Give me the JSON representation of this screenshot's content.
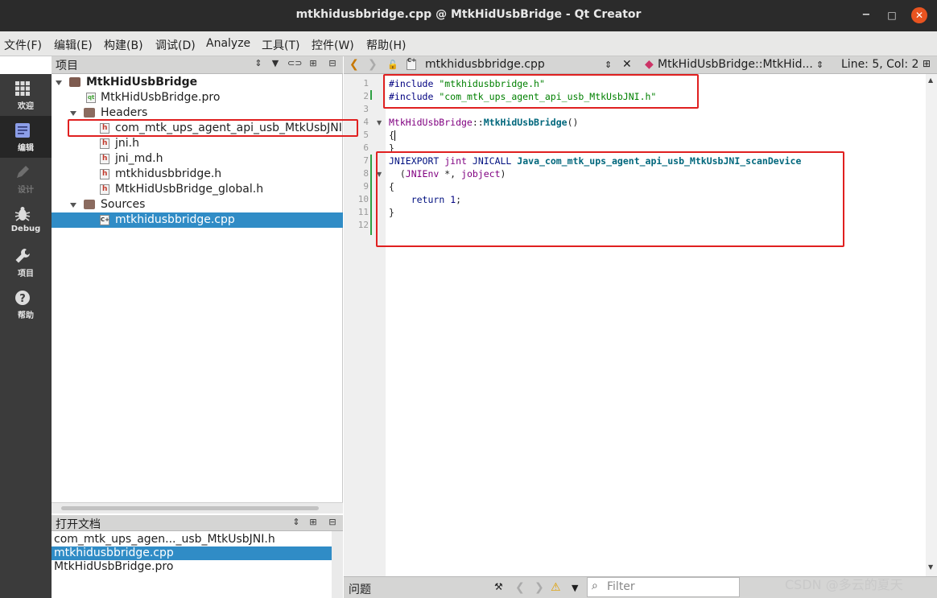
{
  "window": {
    "title": "mtkhidusbbridge.cpp @ MtkHidUsbBridge - Qt Creator",
    "min_glyph": "−",
    "max_glyph": "□",
    "close_glyph": "✕"
  },
  "menu": [
    "文件(F)",
    "编辑(E)",
    "构建(B)",
    "调试(D)",
    "Analyze",
    "工具(T)",
    "控件(W)",
    "帮助(H)"
  ],
  "modes": [
    {
      "label": "欢迎",
      "icon": "grid-icon"
    },
    {
      "label": "编辑",
      "icon": "edit-icon"
    },
    {
      "label": "设计",
      "icon": "pencil-icon"
    },
    {
      "label": "Debug",
      "icon": "bug-icon"
    },
    {
      "label": "项目",
      "icon": "wrench-icon"
    },
    {
      "label": "帮助",
      "icon": "help-icon"
    }
  ],
  "project_pane": {
    "title": "项目",
    "project": "MtkHidUsbBridge",
    "pro_file": "MtkHidUsbBridge.pro",
    "headers_label": "Headers",
    "headers": [
      "com_mtk_ups_agent_api_usb_MtkUsbJNI.h",
      "jni.h",
      "jni_md.h",
      "mtkhidusbbridge.h",
      "MtkHidUsbBridge_global.h"
    ],
    "sources_label": "Sources",
    "sources": [
      "mtkhidusbbridge.cpp"
    ]
  },
  "open_docs": {
    "title": "打开文档",
    "items": [
      "com_mtk_ups_agen..._usb_MtkUsbJNI.h",
      "mtkhidusbbridge.cpp",
      "MtkHidUsbBridge.pro"
    ]
  },
  "editor": {
    "file_name": "mtkhidusbbridge.cpp",
    "symbol": "MtkHidUsbBridge::MtkHid...",
    "position": "Line: 5, Col: 2",
    "line_numbers": [
      "1",
      "2",
      "3",
      "4",
      "5",
      "6",
      "7",
      "8",
      "9",
      "10",
      "11",
      "12"
    ],
    "code": {
      "l1_directive": "#include",
      "l1_string": "\"mtkhidusbbridge.h\"",
      "l2_directive": "#include",
      "l2_string": "\"com_mtk_ups_agent_api_usb_MtkUsbJNI.h\"",
      "l4_class": "MtkHidUsbBridge",
      "l4_sep": "::",
      "l4_ctor": "MtkHidUsbBridge",
      "l4_parens": "()",
      "l5": "{",
      "l6": "}",
      "l7_export": "JNIEXPORT",
      "l7_type": "jint",
      "l7_call": "JNICALL",
      "l7_fn": "Java_com_mtk_ups_agent_api_usb_MtkUsbJNI_scanDevice",
      "l8_open": "  (",
      "l8_t1": "JNIEnv",
      "l8_mid": " *, ",
      "l8_t2": "jobject",
      "l8_close": ")",
      "l9": "{",
      "l10_kw": "return",
      "l10_num": "1",
      "l10_end": ";",
      "l11": "}"
    }
  },
  "output": {
    "issues_label": "问题",
    "filter_placeholder": "Filter"
  },
  "watermark": "CSDN @多云的夏天",
  "colors": {
    "annotation": "#e02020",
    "selection": "#308cc6",
    "modebar": "#3b3b3b"
  }
}
